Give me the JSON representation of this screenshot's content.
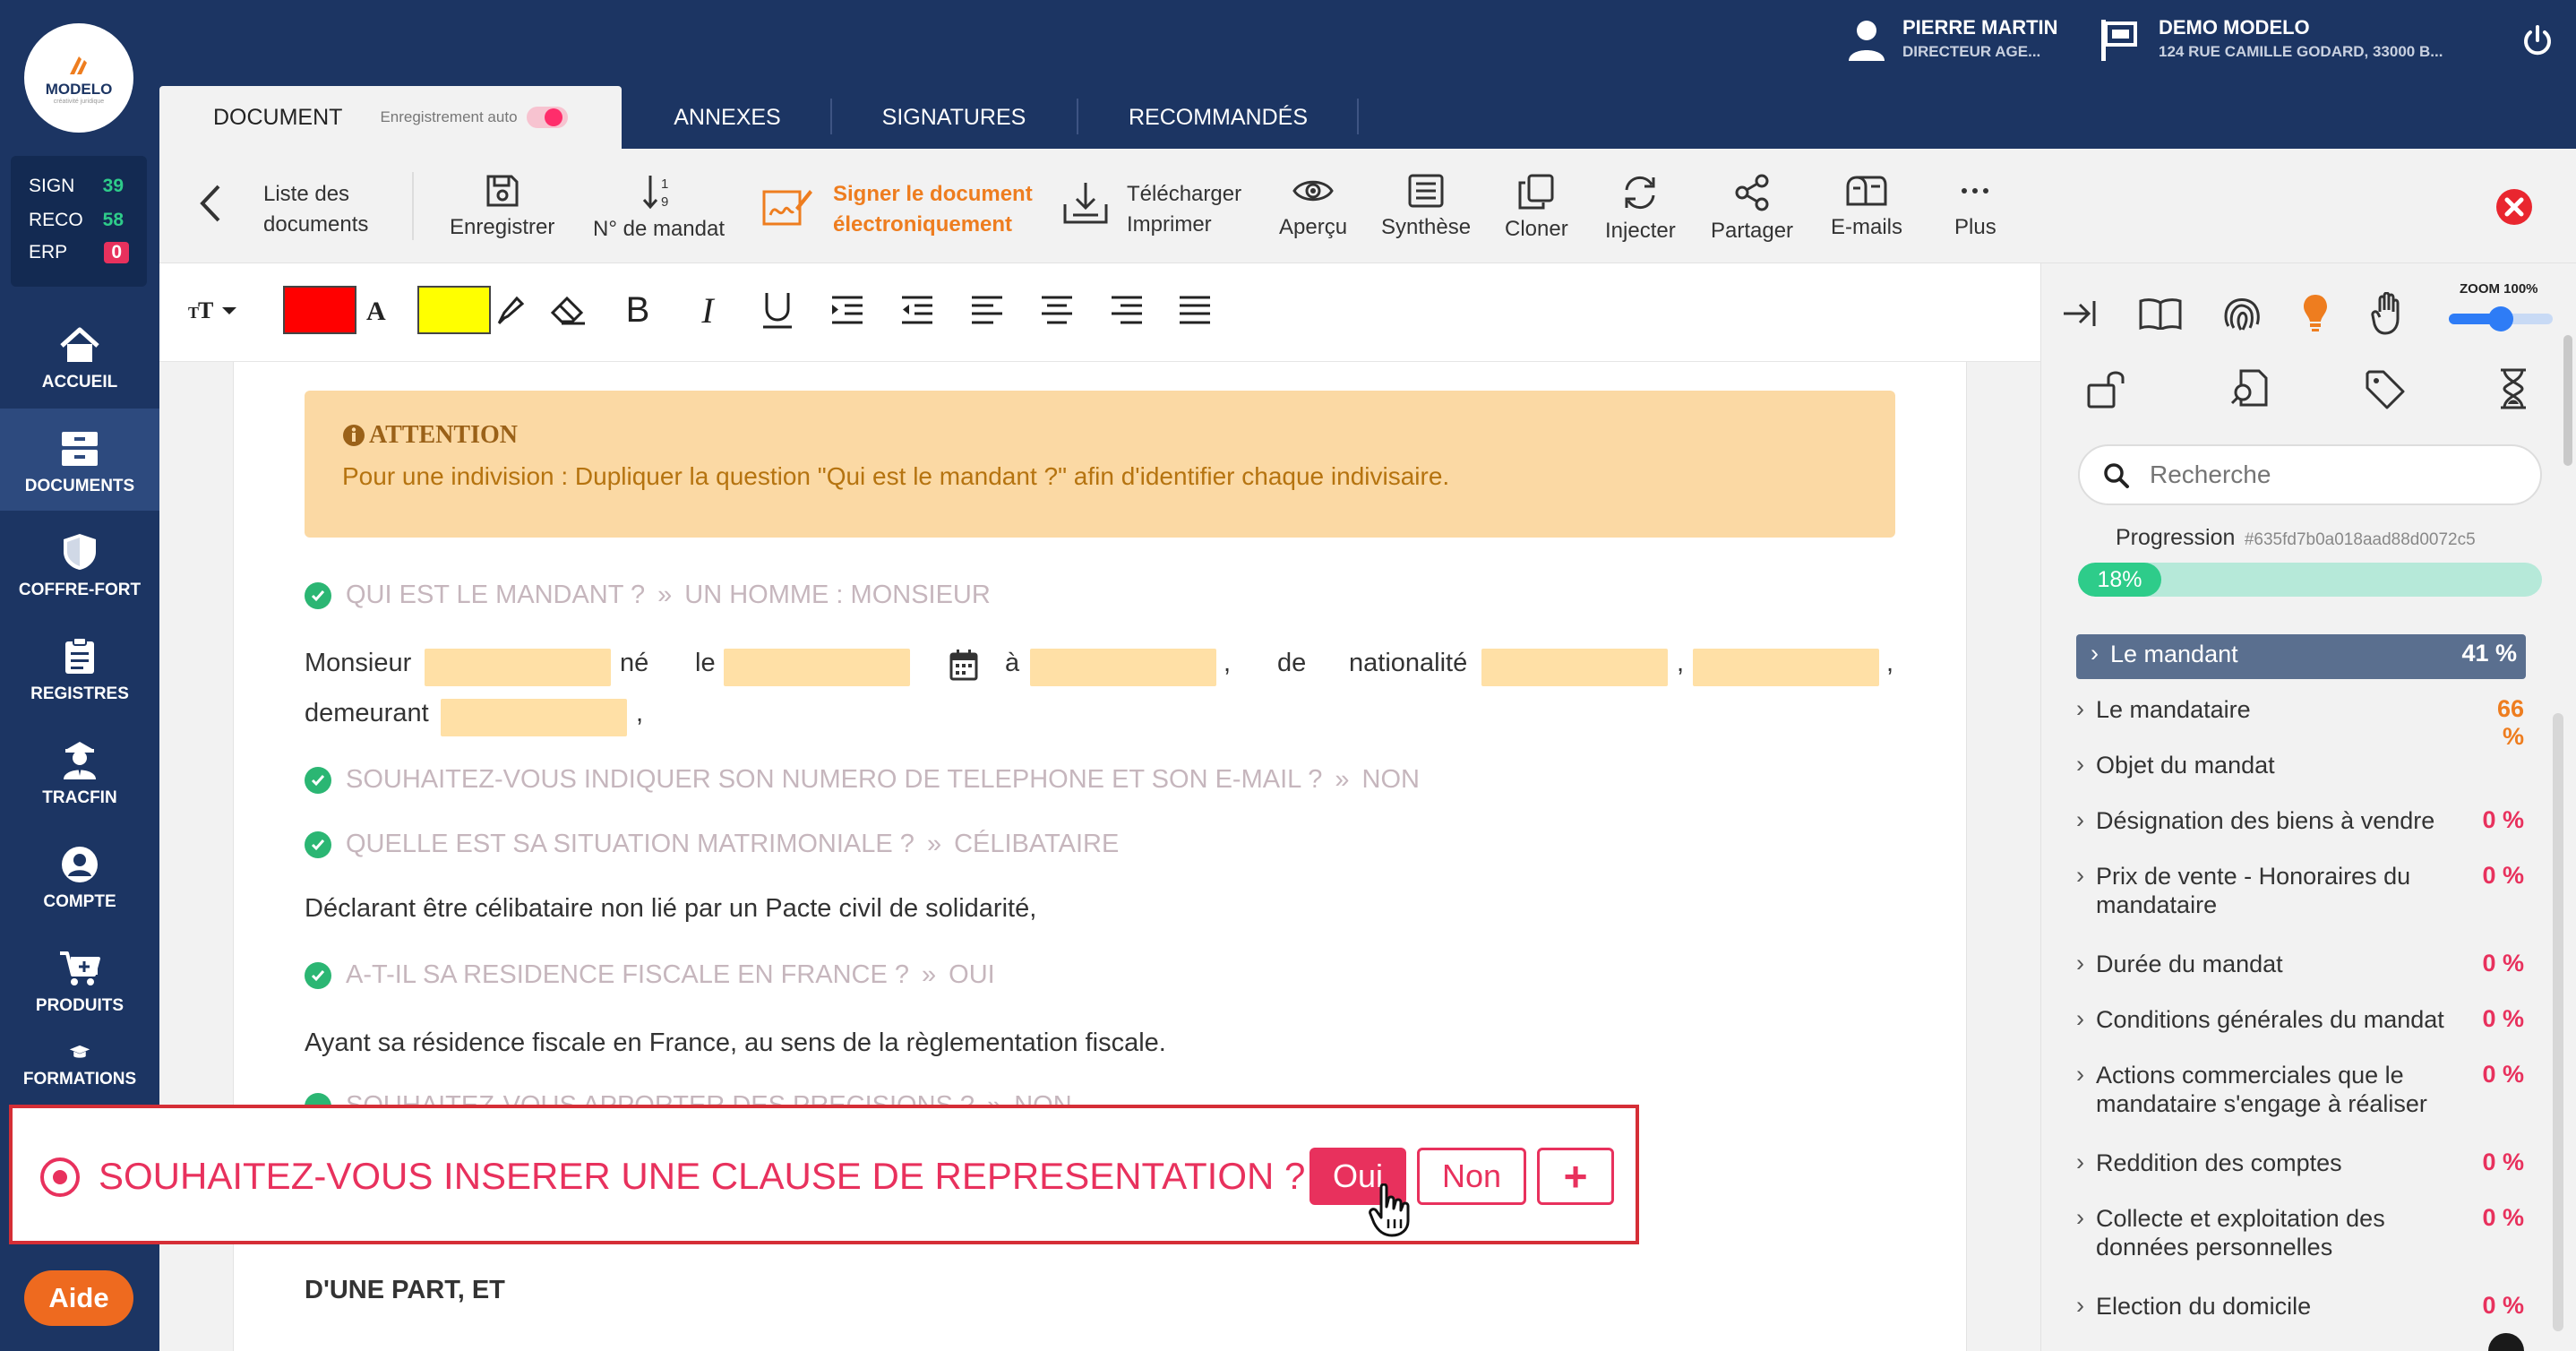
{
  "brand": {
    "name": "MODELO",
    "tagline": "créativité juridique"
  },
  "counters": [
    {
      "label": "SIGN",
      "value": "39",
      "color": "#2ecc8a"
    },
    {
      "label": "RECO",
      "value": "58",
      "color": "#2ecc8a"
    },
    {
      "label": "ERP",
      "value": "0",
      "color": "#e8315d"
    }
  ],
  "nav": [
    {
      "label": "ACCUEIL",
      "icon": "home-icon"
    },
    {
      "label": "DOCUMENTS",
      "icon": "archive-icon",
      "active": true
    },
    {
      "label": "COFFRE-FORT",
      "icon": "shield-icon"
    },
    {
      "label": "REGISTRES",
      "icon": "clipboard-icon"
    },
    {
      "label": "TRACFIN",
      "icon": "agent-icon"
    },
    {
      "label": "COMPTE",
      "icon": "user-icon"
    },
    {
      "label": "PRODUITS",
      "icon": "cart-icon"
    },
    {
      "label": "FORMATIONS",
      "icon": "graduation-icon"
    }
  ],
  "help_label": "Aide",
  "user": {
    "name": "PIERRE MARTIN",
    "role": "DIRECTEUR AGE..."
  },
  "agency": {
    "name": "DEMO MODELO",
    "address": "124 RUE CAMILLE GODARD, 33000 B..."
  },
  "tabs": [
    {
      "label": "DOCUMENT",
      "active": true
    },
    {
      "label": "ANNEXES"
    },
    {
      "label": "SIGNATURES"
    },
    {
      "label": "RECOMMANDÉS"
    }
  ],
  "autosave_label": "Enregistrement auto",
  "toolbar": {
    "back_line1": "Liste des",
    "back_line2": "documents",
    "save": "Enregistrer",
    "mandate_number": "N° de mandat",
    "sign_line1": "Signer le document",
    "sign_line2": "électroniquement",
    "download": "Télécharger",
    "print": "Imprimer",
    "preview": "Aperçu",
    "synthesis": "Synthèse",
    "clone": "Cloner",
    "inject": "Injecter",
    "share": "Partager",
    "emails": "E-mails",
    "more": "Plus"
  },
  "format": {
    "text_color": "#ff0000",
    "highlight_color": "#ffff00"
  },
  "attention": {
    "title": "ATTENTION",
    "body": "Pour une indivision : Dupliquer la question \"Qui est le mandant ?\" afin d'identifier chaque indivisaire."
  },
  "doc": {
    "q1": {
      "question": "QUI EST LE MANDANT ?",
      "answer": "UN HOMME : MONSIEUR"
    },
    "mandant": {
      "monsieur": "Monsieur",
      "ne": "né",
      "le": "le",
      "a": "à",
      "comma": ",",
      "de": "de",
      "nationalite": "nationalité",
      "demeurant": "demeurant"
    },
    "q2": {
      "question": "SOUHAITEZ-VOUS INDIQUER SON NUMERO DE TELEPHONE ET SON E-MAIL ?",
      "answer": "NON"
    },
    "q3": {
      "question": "QUELLE EST SA SITUATION MATRIMONIALE ?",
      "answer": "CÉLIBATAIRE"
    },
    "p3": "Déclarant être célibataire non lié par un Pacte civil de solidarité,",
    "q4": {
      "question": "A-T-IL SA RESIDENCE FISCALE EN FRANCE ?",
      "answer": "OUI"
    },
    "p4": "Ayant sa résidence fiscale en France, au sens de la règlementation fiscale.",
    "q5_partial": "SOUHAITEZ-VOUS APPORTER DES PRECISIONS ?",
    "q5_answer": "NON",
    "closing": "D'UNE PART, ET"
  },
  "callout": {
    "question": "SOUHAITEZ-VOUS INSERER UNE CLAUSE DE REPRESENTATION ?",
    "yes": "Oui",
    "no": "Non",
    "add": "+"
  },
  "right": {
    "zoom": "ZOOM 100%",
    "zoom_value": 0.5,
    "search_placeholder": "Recherche",
    "progress_label": "Progression",
    "progress_id": "#635fd7b0a018aad88d0072c5",
    "progress_value": "18%",
    "progress_fraction": 0.18,
    "sections": [
      {
        "name": "Le mandant",
        "pct": "41 %",
        "active": true
      },
      {
        "name": "Le mandataire",
        "pct": "66 %",
        "color": "#ee7d1f"
      },
      {
        "name": "Objet du mandat",
        "pct": ""
      },
      {
        "name": "Désignation des biens à vendre",
        "pct": "0 %"
      },
      {
        "name": "Prix de vente - Honoraires du mandataire",
        "pct": "0 %"
      },
      {
        "name": "Durée du mandat",
        "pct": "0 %"
      },
      {
        "name": "Conditions générales du mandat",
        "pct": "0 %"
      },
      {
        "name": "Actions commerciales que le mandataire s'engage à réaliser",
        "pct": "0 %"
      },
      {
        "name": "Reddition des comptes",
        "pct": "0 %"
      },
      {
        "name": "Collecte et exploitation des données personnelles",
        "pct": "0 %"
      },
      {
        "name": "Election du domicile",
        "pct": "0 %"
      }
    ]
  }
}
